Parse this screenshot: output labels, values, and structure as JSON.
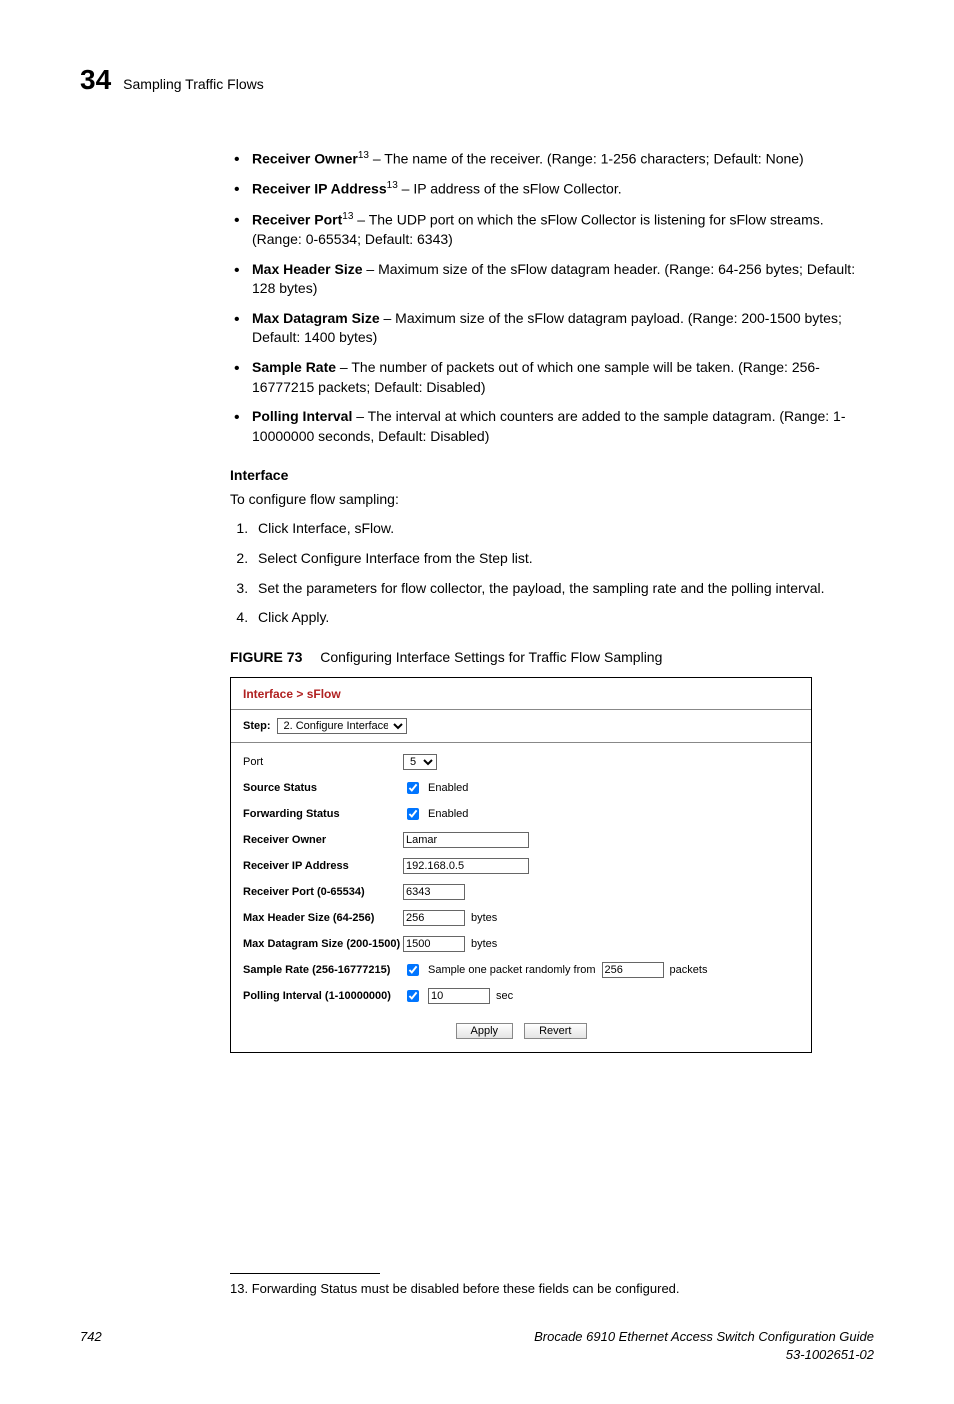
{
  "header": {
    "chapter_num": "34",
    "chapter_title": "Sampling Traffic Flows"
  },
  "bullets": [
    {
      "term": "Receiver Owner",
      "sup": "13",
      "desc": " – The name of the receiver. (Range: 1-256 characters; Default: None)"
    },
    {
      "term": "Receiver IP Address",
      "sup": "13",
      "desc": " – IP address of the sFlow Collector."
    },
    {
      "term": "Receiver Port",
      "sup": "13",
      "desc": " – The UDP port on which the sFlow Collector is listening for sFlow streams. (Range: 0-65534; Default: 6343)"
    },
    {
      "term": "Max Header Size",
      "sup": "",
      "desc": " – Maximum size of the sFlow datagram header. (Range: 64-256 bytes; Default: 128 bytes)"
    },
    {
      "term": "Max Datagram Size",
      "sup": "",
      "desc": " – Maximum size of the sFlow datagram payload. (Range: 200-1500 bytes; Default: 1400 bytes)"
    },
    {
      "term": "Sample Rate",
      "sup": "",
      "desc": " – The number of packets out of which one sample will be taken. (Range: 256-16777215 packets; Default: Disabled)"
    },
    {
      "term": "Polling Interval",
      "sup": "",
      "desc": " – The interval at which counters are added to the sample datagram. (Range: 1-10000000 seconds, Default: Disabled)"
    }
  ],
  "interface": {
    "heading": "Interface",
    "intro": "To configure flow sampling:",
    "steps": [
      "Click Interface, sFlow.",
      "Select Configure Interface from the Step list.",
      "Set the parameters for flow collector, the payload, the sampling rate and the polling interval.",
      "Click Apply."
    ]
  },
  "figure": {
    "label": "FIGURE 73",
    "caption": "Configuring Interface Settings for Traffic Flow Sampling",
    "breadcrumb": "Interface > sFlow",
    "step_label": "Step:",
    "step_value": "2. Configure Interface",
    "rows": {
      "port_label": "Port",
      "port_value": "5",
      "source_label": "Source Status",
      "source_checked": true,
      "source_text": "Enabled",
      "fwd_label": "Forwarding Status",
      "fwd_checked": true,
      "fwd_text": "Enabled",
      "owner_label": "Receiver Owner",
      "owner_value": "Lamar",
      "ip_label": "Receiver IP Address",
      "ip_value": "192.168.0.5",
      "rport_label": "Receiver Port (0-65534)",
      "rport_value": "6343",
      "mhs_label": "Max Header Size (64-256)",
      "mhs_value": "256",
      "mhs_unit": "bytes",
      "mds_label": "Max Datagram Size (200-1500)",
      "mds_value": "1500",
      "mds_unit": "bytes",
      "sr_label": "Sample Rate (256-16777215)",
      "sr_checked": true,
      "sr_text": "Sample one packet randomly from",
      "sr_value": "256",
      "sr_unit": "packets",
      "pi_label": "Polling Interval (1-10000000)",
      "pi_checked": true,
      "pi_value": "10",
      "pi_unit": "sec"
    },
    "buttons": {
      "apply": "Apply",
      "revert": "Revert"
    }
  },
  "footnote": {
    "num": "13.",
    "text": "Forwarding Status must be disabled before these fields can be configured."
  },
  "footer": {
    "page": "742",
    "title": "Brocade 6910 Ethernet Access Switch Configuration Guide",
    "docnum": "53-1002651-02"
  }
}
